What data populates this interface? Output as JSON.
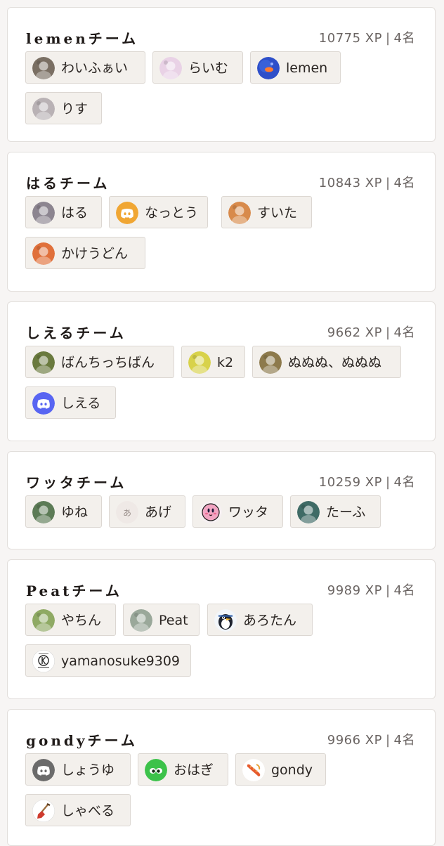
{
  "teams": [
    {
      "name": "lemenチーム",
      "xp": "10775 XP",
      "count": "4名",
      "members": [
        {
          "name": "わいふぁい",
          "avatar": "photo-avatar-rock",
          "color": "#7a6f63"
        },
        {
          "name": "らいむ",
          "avatar": "anime-avatar-pink",
          "color": "#e9d2e6"
        },
        {
          "name": "lemen",
          "avatar": "photo-avatar-blue-fish",
          "color": "#2e4fc9"
        },
        {
          "name": "りす",
          "avatar": "anime-avatar-gray",
          "color": "#b9b2b5"
        }
      ]
    },
    {
      "name": "はるチーム",
      "xp": "10843 XP",
      "count": "4名",
      "members": [
        {
          "name": "はる",
          "avatar": "anime-avatar-rabbit",
          "color": "#8c8590"
        },
        {
          "name": "なっとう",
          "avatar": "discord-icon",
          "color": "#f0a633"
        },
        {
          "name": "すいた",
          "avatar": "anime-avatar-orange",
          "color": "#d88a4b"
        },
        {
          "name": "かけうどん",
          "avatar": "anime-avatar-squid",
          "color": "#e0703b"
        }
      ]
    },
    {
      "name": "しえるチーム",
      "xp": "9662 XP",
      "count": "4名",
      "members": [
        {
          "name": "ばんちっちばん",
          "avatar": "anime-avatar-bird",
          "color": "#6a7a3e"
        },
        {
          "name": "k2",
          "avatar": "anime-avatar-yellow",
          "color": "#d8d24a"
        },
        {
          "name": "ぬぬぬ、ぬぬぬ",
          "avatar": "photo-avatar-dogs",
          "color": "#8d7a4c"
        },
        {
          "name": "しえる",
          "avatar": "discord-icon",
          "color": "#5865f2"
        }
      ]
    },
    {
      "name": "ワッタチーム",
      "xp": "10259 XP",
      "count": "4名",
      "members": [
        {
          "name": "ゆね",
          "avatar": "photo-avatar-landscape",
          "color": "#5c7b56"
        },
        {
          "name": "あげ",
          "avatar": "letter-avatar",
          "color": "#efe9e6",
          "initial": "あ"
        },
        {
          "name": "ワッタ",
          "avatar": "kirby-avatar",
          "color": "#f2a5c3"
        },
        {
          "name": "たーふ",
          "avatar": "anime-avatar-teal",
          "color": "#3f6b66"
        }
      ]
    },
    {
      "name": "Peatチーム",
      "xp": "9989 XP",
      "count": "4名",
      "members": [
        {
          "name": "やちん",
          "avatar": "anime-avatar-green",
          "color": "#8faa64"
        },
        {
          "name": "Peat",
          "avatar": "anime-avatar-white",
          "color": "#9aa89a"
        },
        {
          "name": "あろたん",
          "avatar": "penguin-avatar",
          "color": "#2f5fa8"
        },
        {
          "name": "yamanosuke9309",
          "avatar": "emblem-avatar",
          "color": "#ffffff"
        }
      ]
    },
    {
      "name": "gondyチーム",
      "xp": "9966 XP",
      "count": "4名",
      "members": [
        {
          "name": "しょうゆ",
          "avatar": "discord-icon",
          "color": "#6b6b6b"
        },
        {
          "name": "おはぎ",
          "avatar": "squid-eyes-avatar",
          "color": "#3cc24a"
        },
        {
          "name": "gondy",
          "avatar": "sausage-avatar",
          "color": "#e65a2c"
        },
        {
          "name": "しゃべる",
          "avatar": "shovel-avatar",
          "color": "#ffffff"
        }
      ]
    }
  ]
}
